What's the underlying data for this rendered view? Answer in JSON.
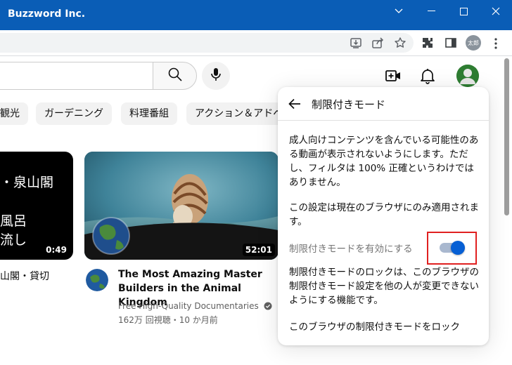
{
  "window": {
    "title": "Buzzword Inc.",
    "controls": [
      "chevron-down-icon",
      "minimize-icon",
      "maximize-icon",
      "close-icon"
    ]
  },
  "browser": {
    "toolbar_icons": [
      "install-app-icon",
      "share-icon",
      "bookmark-star-icon",
      "extensions-icon",
      "side-panel-icon"
    ],
    "profile_label": "太郎",
    "menu_icon": "more-vert-icon"
  },
  "youtube": {
    "header_icons": [
      "search-icon",
      "mic-icon",
      "create-video-icon",
      "notifications-bell-icon"
    ],
    "chips": [
      "観光",
      "ガーデニング",
      "料理番組",
      "アクション＆アドベ"
    ],
    "videos": [
      {
        "thumb_lines": [
          "・泉山閣",
          "風呂",
          "流し"
        ],
        "duration": "0:49",
        "caption": "山閣・貸切"
      },
      {
        "title": "The Most Amazing Master Builders in the Animal Kingdom",
        "channel": "Free High-Quality Documentaries",
        "verified_icon": "verified-check-icon",
        "meta": "162万 回視聴・10 か月前",
        "duration": "52:01"
      }
    ]
  },
  "restricted_panel": {
    "title": "制限付きモード",
    "description": "成人向けコンテンツを含んでいる可能性のある動画が表示されないようにします。ただし、フィルタは 100% 正確というわけではありません。",
    "browser_note": "この設定は現在のブラウザにのみ適用されます。",
    "toggle_label": "制限付きモードを有効にする",
    "toggle_on": true,
    "lock_description": "制限付きモードのロックは、このブラウザの制限付きモード設定を他の人が変更できないようにする機能です。",
    "lock_link": "このブラウザの制限付きモードをロック"
  },
  "colors": {
    "title_bar": "#0a5db6",
    "toggle_knob": "#065fd4",
    "highlight_box": "#e02020"
  }
}
